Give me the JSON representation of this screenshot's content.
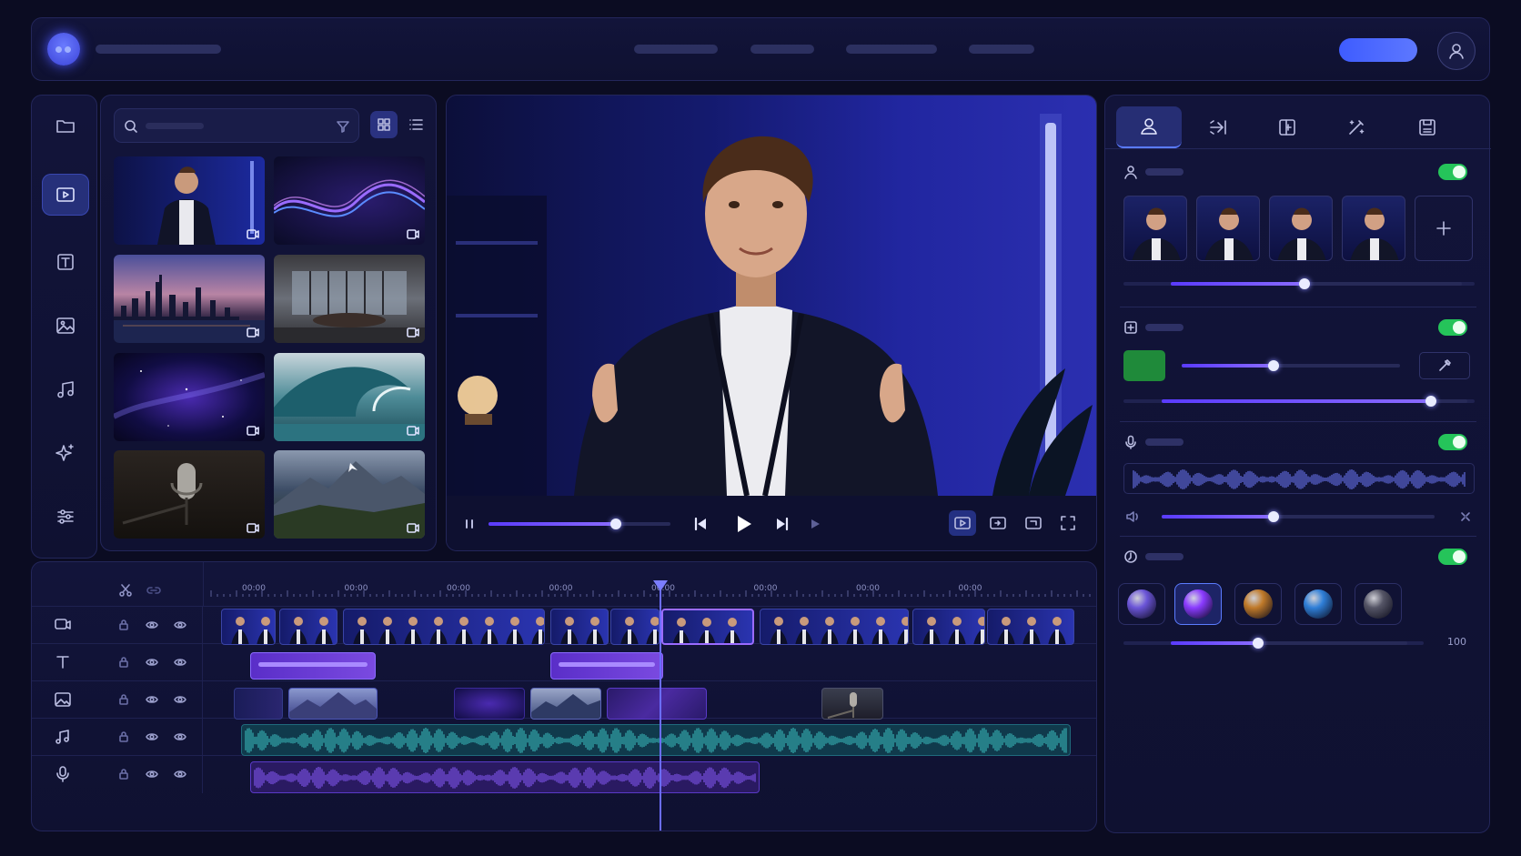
{
  "header": {
    "logo_icon": "logo-icon",
    "nav_items": [
      "",
      "",
      "",
      ""
    ],
    "accent": "#4b62ff",
    "user_icon": "user-icon"
  },
  "sidebar": {
    "items": [
      {
        "icon": "folder-icon",
        "active": false
      },
      {
        "icon": "video-icon",
        "active": true
      },
      {
        "icon": "text-icon",
        "active": false
      },
      {
        "icon": "image-icon",
        "active": false
      },
      {
        "icon": "music-icon",
        "active": false
      },
      {
        "icon": "sparkle-icon",
        "active": false
      },
      {
        "icon": "sliders-icon",
        "active": false
      }
    ]
  },
  "media": {
    "search_placeholder": "",
    "view_mode": "grid",
    "thumbnails": [
      {
        "subject": "presenter",
        "type": "video"
      },
      {
        "subject": "purple-waves",
        "type": "video"
      },
      {
        "subject": "city-skyline",
        "type": "video"
      },
      {
        "subject": "office-room",
        "type": "video"
      },
      {
        "subject": "galaxy",
        "type": "video"
      },
      {
        "subject": "ocean-wave",
        "type": "video"
      },
      {
        "subject": "microphone",
        "type": "video"
      },
      {
        "subject": "mountains",
        "type": "video"
      }
    ]
  },
  "player": {
    "progress": 0.7,
    "state": "paused"
  },
  "inspector": {
    "tabs": [
      "avatar-tab",
      "transition-tab",
      "layout-tab",
      "magic-tab",
      "export-tab"
    ],
    "active_tab": 0,
    "avatar": {
      "enabled": true,
      "count": 4,
      "slider": 0.46
    },
    "background": {
      "enabled": true,
      "color": "#1f8a3a",
      "slider_a": 0.42,
      "slider_b": 0.88
    },
    "voice": {
      "enabled": true,
      "volume": 0.41
    },
    "style": {
      "enabled": true,
      "selected": 1,
      "orbs": [
        "#6b55d8",
        "#8a3bff",
        "#c07a2a",
        "#2f7fd8",
        "#555566"
      ],
      "value": "100",
      "slider": 0.37
    }
  },
  "timeline": {
    "tick_labels": [
      "00:00",
      "00:00",
      "00:00",
      "00:00",
      "00:00",
      "00:00",
      "00:00",
      "00:00"
    ],
    "tracks": [
      {
        "icon": "video-track-icon",
        "kind": "video"
      },
      {
        "icon": "text-track-icon",
        "kind": "text"
      },
      {
        "icon": "image-track-icon",
        "kind": "image"
      },
      {
        "icon": "music-track-icon",
        "kind": "music"
      },
      {
        "icon": "mic-track-icon",
        "kind": "voice"
      }
    ],
    "playhead": 0.54
  }
}
